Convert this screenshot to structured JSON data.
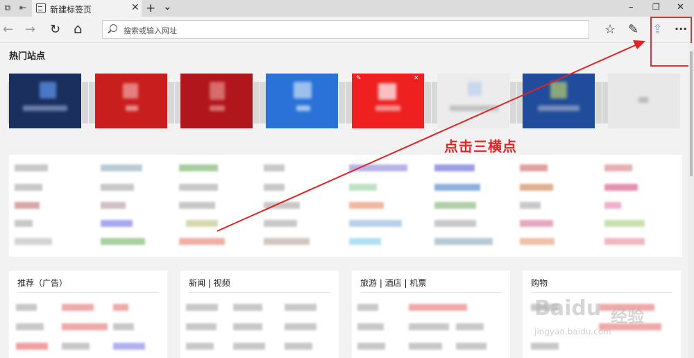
{
  "tab": {
    "title": "新建标签页"
  },
  "window": {
    "new_tab": "+",
    "tab_list": "⌄",
    "minimize": "–",
    "restore": "❐",
    "close": "✕"
  },
  "nav": {
    "back": "←",
    "forward": "→",
    "refresh": "↻",
    "home": "⌂",
    "favorites": "☆",
    "notes": "✎",
    "share": "⇪",
    "more": "···"
  },
  "addressbar": {
    "placeholder": "搜索或输入网址"
  },
  "sections": {
    "hot_sites": "热门站点"
  },
  "annotation": {
    "text": "点击三横点",
    "color": "#e02222"
  },
  "cards": [
    {
      "title": "推荐（广告）"
    },
    {
      "title": "新闻 | 视频"
    },
    {
      "title": "旅游 | 酒店 | 机票"
    },
    {
      "title": "购物"
    }
  ],
  "watermark": {
    "brand": "Baidu",
    "cn": "经验",
    "url": "jingyan.baidu.com"
  },
  "tiles": [
    {
      "color": "#1a2f5e"
    },
    {
      "color": "#c81e1e"
    },
    {
      "color": "#b0161c"
    },
    {
      "color": "#2a72d8"
    },
    {
      "color": "#ee2020"
    },
    {
      "color": "#ececec"
    },
    {
      "color": "#214c9b"
    },
    {
      "color": "#e8e8e8"
    }
  ]
}
